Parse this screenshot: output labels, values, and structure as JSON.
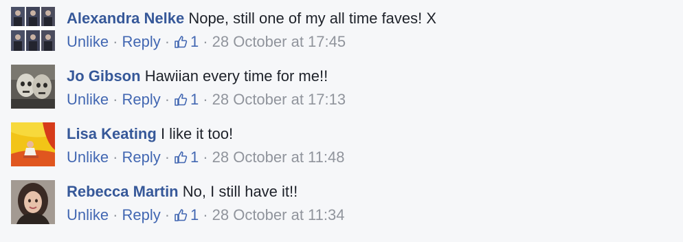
{
  "comments": [
    {
      "author": "Alexandra Nelke",
      "text": "Nope, still one of my all time faves! X",
      "unlike_label": "Unlike",
      "reply_label": "Reply",
      "like_count": "1",
      "timestamp": "28 October at 17:45",
      "avatar_icon": "profile-photo-grid"
    },
    {
      "author": "Jo Gibson",
      "text": "Hawiian every time for me!!",
      "unlike_label": "Unlike",
      "reply_label": "Reply",
      "like_count": "1",
      "timestamp": "28 October at 17:13",
      "avatar_icon": "profile-photo-zombie-couple"
    },
    {
      "author": "Lisa Keating",
      "text": "I like it too!",
      "unlike_label": "Unlike",
      "reply_label": "Reply",
      "like_count": "1",
      "timestamp": "28 October at 11:48",
      "avatar_icon": "profile-photo-bouncy-castle"
    },
    {
      "author": "Rebecca Martin",
      "text": "No, I still have it!!",
      "unlike_label": "Unlike",
      "reply_label": "Reply",
      "like_count": "1",
      "timestamp": "28 October at 11:34",
      "avatar_icon": "profile-photo-portrait"
    }
  ],
  "separator": "·",
  "colors": {
    "author": "#365899",
    "action": "#4267b2",
    "meta": "#90949c",
    "text": "#1d2129",
    "background": "#f6f7f9"
  }
}
